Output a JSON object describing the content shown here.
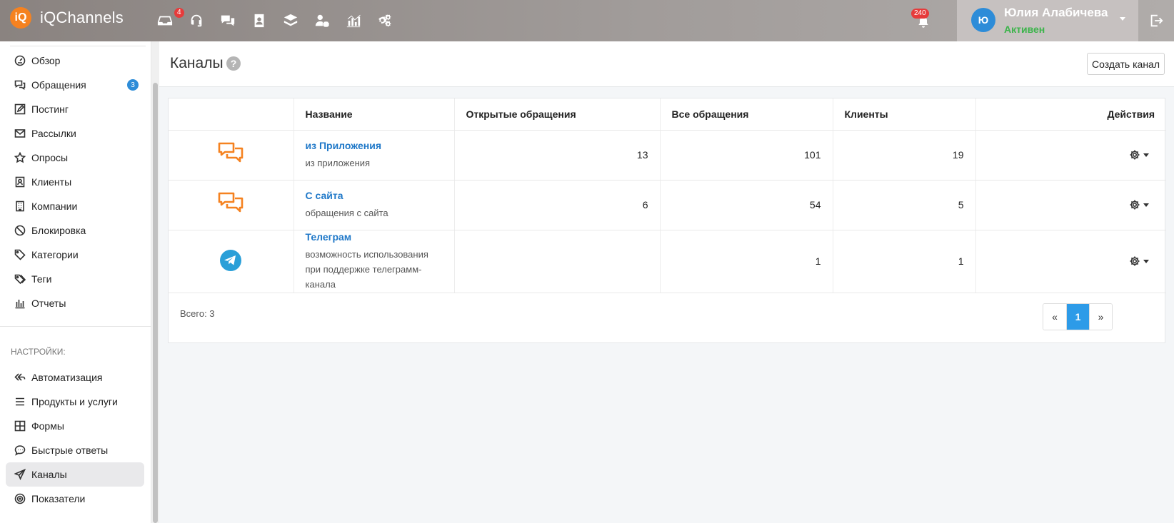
{
  "app": {
    "logo_mark": "iQ",
    "name": "iQChannels"
  },
  "topbar": {
    "nav": [
      {
        "icon": "inbox-icon",
        "badge": "4"
      },
      {
        "icon": "headset-icon"
      },
      {
        "icon": "chat-bubbles-icon"
      },
      {
        "icon": "contact-book-icon"
      },
      {
        "icon": "layers-icon"
      },
      {
        "icon": "user-settings-icon"
      },
      {
        "icon": "analytics-chart-icon"
      },
      {
        "icon": "gears-icon"
      }
    ],
    "notifications_badge": "240",
    "user": {
      "initial": "Ю",
      "name": "Юлия Алабичева",
      "status": "Активен",
      "status_color": "#3cb44b"
    }
  },
  "sidebar": {
    "items": [
      {
        "label": "Обзор",
        "icon": "dashboard-icon"
      },
      {
        "label": "Обращения",
        "icon": "chat-icon",
        "badge": "3"
      },
      {
        "label": "Постинг",
        "icon": "edit-icon"
      },
      {
        "label": "Рассылки",
        "icon": "mail-icon"
      },
      {
        "label": "Опросы",
        "icon": "star-icon"
      },
      {
        "label": "Клиенты",
        "icon": "contact-icon"
      },
      {
        "label": "Компании",
        "icon": "building-icon"
      },
      {
        "label": "Блокировка",
        "icon": "block-icon"
      },
      {
        "label": "Категории",
        "icon": "tag-icon"
      },
      {
        "label": "Теги",
        "icon": "tags-icon"
      },
      {
        "label": "Отчеты",
        "icon": "bar-chart-icon"
      }
    ],
    "settings_title": "НАСТРОЙКИ:",
    "settings_items": [
      {
        "label": "Автоматизация",
        "icon": "automation-icon"
      },
      {
        "label": "Продукты и услуги",
        "icon": "list-icon"
      },
      {
        "label": "Формы",
        "icon": "grid-icon"
      },
      {
        "label": "Быстрые ответы",
        "icon": "quick-reply-icon"
      },
      {
        "label": "Каналы",
        "icon": "send-icon",
        "active": true
      },
      {
        "label": "Показатели",
        "icon": "target-icon"
      }
    ]
  },
  "page": {
    "title": "Каналы",
    "help": "?",
    "create_button": "Создать канал"
  },
  "table": {
    "headers": [
      "",
      "Название",
      "Открытые обращения",
      "Все обращения",
      "Клиенты",
      "Действия"
    ],
    "rows": [
      {
        "icon": "chat-bubbles-icon",
        "name": "из Приложения",
        "desc": "из приложения",
        "open": "13",
        "all": "101",
        "clients": "19"
      },
      {
        "icon": "chat-bubbles-icon",
        "name": "С сайта",
        "desc": "обращения с сайта",
        "open": "6",
        "all": "54",
        "clients": "5"
      },
      {
        "icon": "telegram-icon",
        "name": "Телеграм",
        "desc": "возможность использования при поддержке телеграмм-канала",
        "open": "",
        "all": "1",
        "clients": "1"
      }
    ],
    "total": "Всего: 3"
  },
  "pagination": {
    "prev": "«",
    "current": "1",
    "next": "»"
  },
  "colors": {
    "accent": "#2d9be8",
    "link": "#1f78c8",
    "logo": "#f58220",
    "channel_icon": "#f58220",
    "telegram": "#2a9fd8"
  }
}
